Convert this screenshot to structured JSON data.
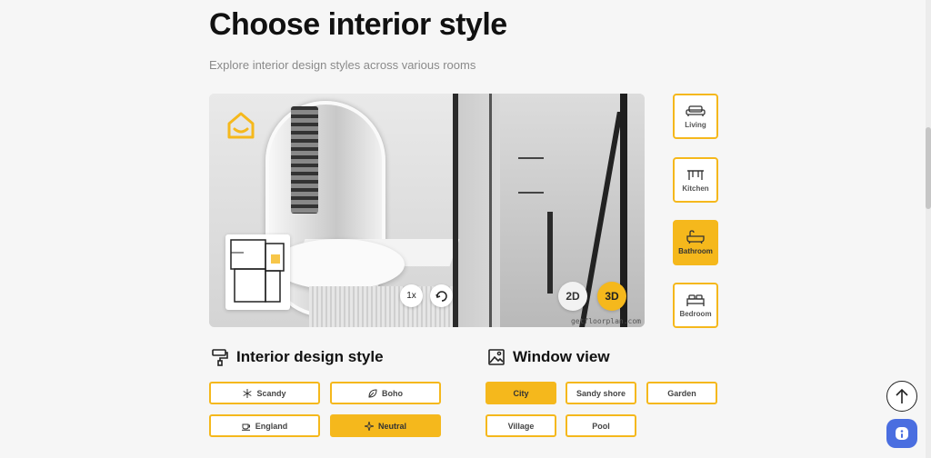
{
  "header": {
    "title": "Choose interior style",
    "subtitle": "Explore interior design styles across various rooms"
  },
  "viewer": {
    "zoom_label": "1x",
    "mode_2d": "2D",
    "mode_3d": "3D",
    "active_mode": "3D",
    "watermark": "getfloorplan.com",
    "icons": [
      "home-logo-icon",
      "floor-plan-thumbnail",
      "rotate-icon"
    ]
  },
  "rooms": [
    {
      "label": "Living",
      "icon": "sofa-icon",
      "active": false
    },
    {
      "label": "Kitchen",
      "icon": "table-icon",
      "active": false
    },
    {
      "label": "Bathroom",
      "icon": "bathtub-icon",
      "active": true
    },
    {
      "label": "Bedroom",
      "icon": "bed-icon",
      "active": false
    }
  ],
  "design_style": {
    "heading": "Interior design style",
    "options": [
      {
        "label": "Scandy",
        "icon": "snowflake-icon",
        "active": false
      },
      {
        "label": "Boho",
        "icon": "leaf-icon",
        "active": false
      },
      {
        "label": "England",
        "icon": "teacup-icon",
        "active": false
      },
      {
        "label": "Neutral",
        "icon": "sparkle-icon",
        "active": true
      }
    ]
  },
  "window_view": {
    "heading": "Window view",
    "options": [
      {
        "label": "City",
        "active": true
      },
      {
        "label": "Sandy shore",
        "active": false
      },
      {
        "label": "Garden",
        "active": false
      },
      {
        "label": "Village",
        "active": false
      },
      {
        "label": "Pool",
        "active": false
      }
    ]
  },
  "colors": {
    "accent": "#f5b81c",
    "chat_button": "#4a6ee0",
    "background": "#f6f6f6"
  }
}
